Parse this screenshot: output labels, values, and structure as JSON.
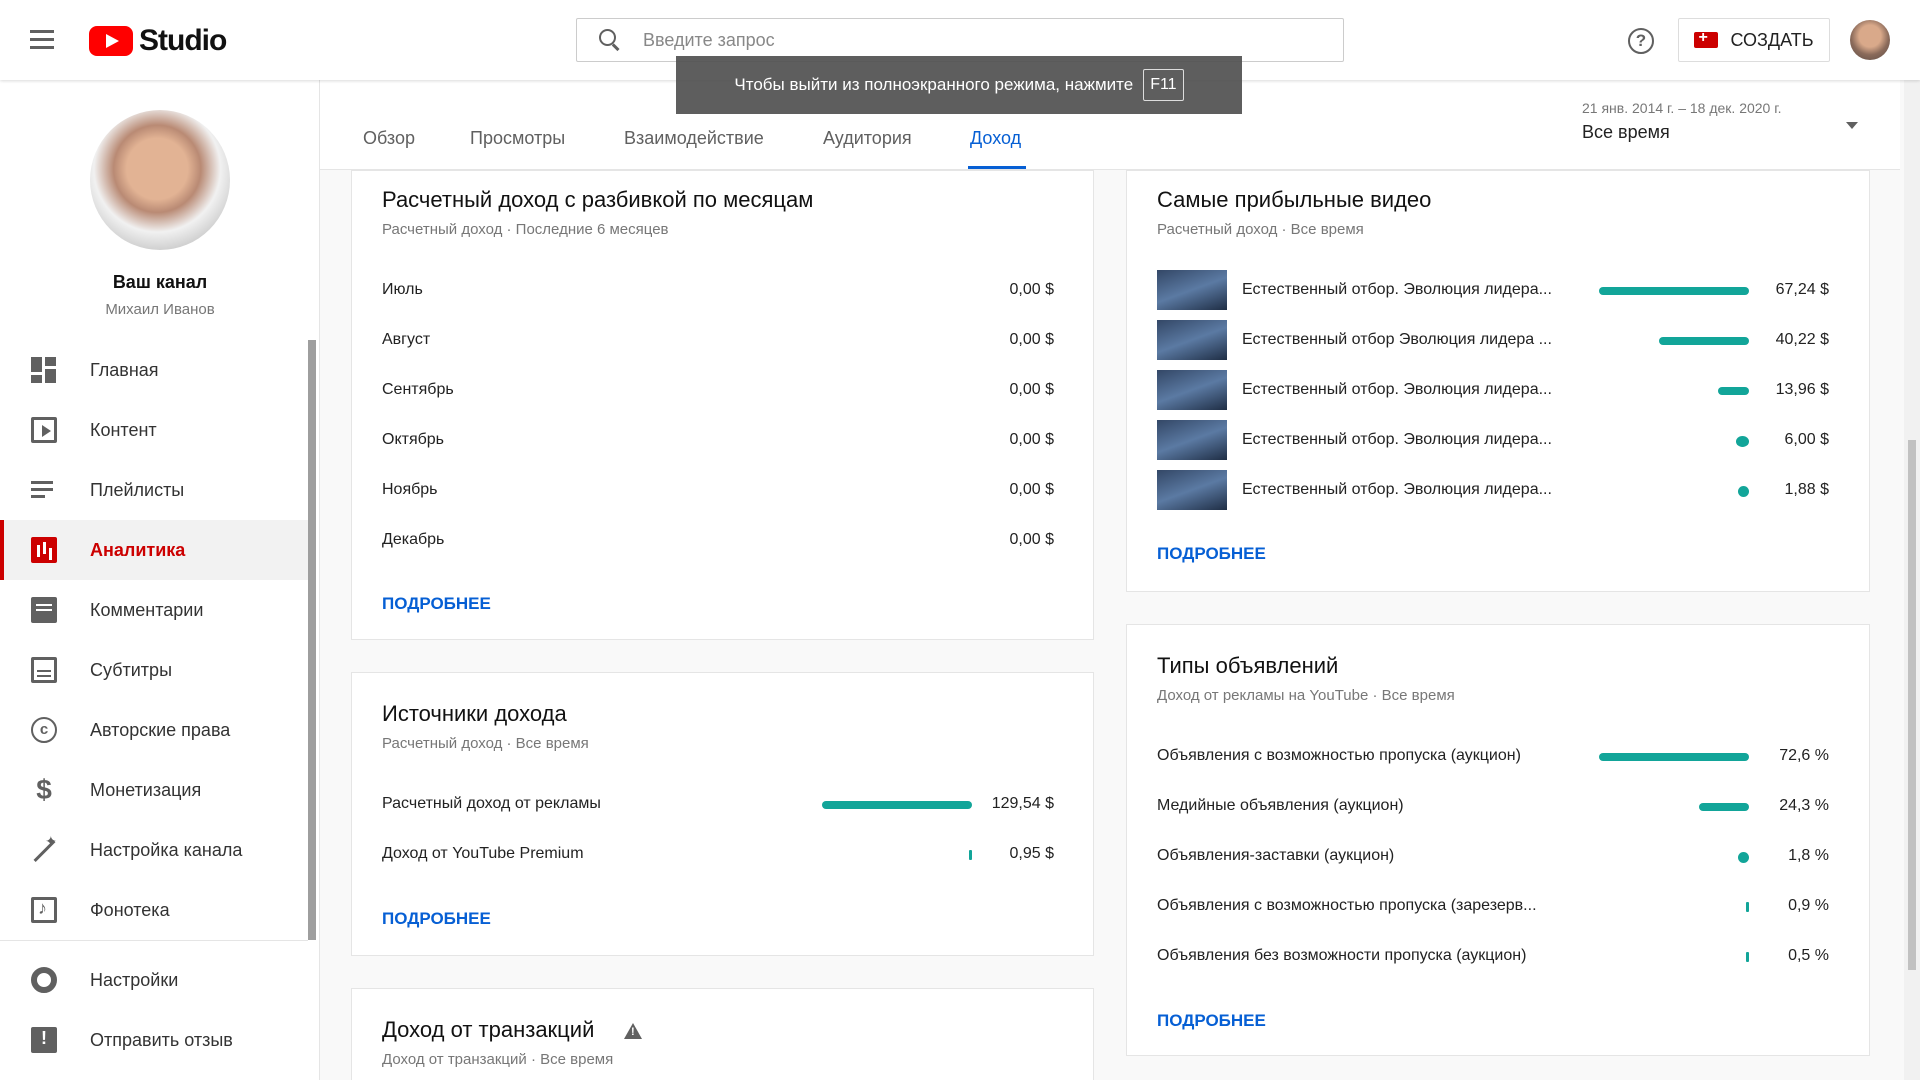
{
  "header": {
    "logo_text": "Studio",
    "search_placeholder": "Введите запрос",
    "help_glyph": "?",
    "create_label": "СОЗДАТЬ"
  },
  "toast": {
    "text": "Чтобы выйти из полноэкранного режима, нажмите",
    "key": "F11"
  },
  "sidebar": {
    "channel_name": "Ваш канал",
    "channel_owner": "Михаил Иванов",
    "items": [
      {
        "label": "Главная",
        "icon": "dashboard-icon"
      },
      {
        "label": "Контент",
        "icon": "video-library-icon"
      },
      {
        "label": "Плейлисты",
        "icon": "playlist-icon"
      },
      {
        "label": "Аналитика",
        "icon": "analytics-icon",
        "active": true
      },
      {
        "label": "Комментарии",
        "icon": "comment-icon"
      },
      {
        "label": "Субтитры",
        "icon": "subtitles-icon"
      },
      {
        "label": "Авторские права",
        "icon": "copyright-icon"
      },
      {
        "label": "Монетизация",
        "icon": "dollar-icon"
      },
      {
        "label": "Настройка канала",
        "icon": "magic-wand-icon"
      },
      {
        "label": "Фонотека",
        "icon": "audio-library-icon"
      }
    ],
    "bottom_items": [
      {
        "label": "Настройки",
        "icon": "gear-icon"
      },
      {
        "label": "Отправить отзыв",
        "icon": "feedback-icon"
      }
    ]
  },
  "tabs": [
    {
      "label": "Обзор"
    },
    {
      "label": "Просмотры"
    },
    {
      "label": "Взаимодействие"
    },
    {
      "label": "Аудитория"
    },
    {
      "label": "Доход",
      "active": true
    }
  ],
  "date_range": {
    "range_text": "21 янв. 2014 г. – 18 дек. 2020 г.",
    "selected": "Все время"
  },
  "monthly_revenue": {
    "title": "Расчетный доход с разбивкой по месяцам",
    "subtitle": "Расчетный доход · Последние 6 месяцев",
    "rows": [
      {
        "label": "Июль",
        "value": "0,00 $"
      },
      {
        "label": "Август",
        "value": "0,00 $"
      },
      {
        "label": "Сентябрь",
        "value": "0,00 $"
      },
      {
        "label": "Октябрь",
        "value": "0,00 $"
      },
      {
        "label": "Ноябрь",
        "value": "0,00 $"
      },
      {
        "label": "Декабрь",
        "value": "0,00 $"
      }
    ],
    "more": "ПОДРОБНЕЕ"
  },
  "revenue_sources": {
    "title": "Источники дохода",
    "subtitle": "Расчетный доход · Все время",
    "rows": [
      {
        "label": "Расчетный доход от рекламы",
        "value": "129,54 $",
        "share": 1.0
      },
      {
        "label": "Доход от YouTube Premium",
        "value": "0,95 $",
        "share": 0.007
      }
    ],
    "more": "ПОДРОБНЕЕ"
  },
  "transactions": {
    "title": "Доход от транзакций",
    "subtitle": "Доход от транзакций · Все время",
    "warning_icon": "warning-icon"
  },
  "top_videos": {
    "title": "Самые прибыльные видео",
    "subtitle": "Расчетный доход · Все время",
    "rows": [
      {
        "label": "Естественный отбор. Эволюция лидера...",
        "value": "67,24 $",
        "share": 1.0
      },
      {
        "label": "Естественный отбор Эволюция лидера ...",
        "value": "40,22 $",
        "share": 0.598
      },
      {
        "label": "Естественный отбор. Эволюция лидера...",
        "value": "13,96 $",
        "share": 0.208
      },
      {
        "label": "Естественный отбор. Эволюция лидера...",
        "value": "6,00 $",
        "share": 0.089
      },
      {
        "label": "Естественный отбор. Эволюция лидера...",
        "value": "1,88 $",
        "share": 0.028
      }
    ],
    "more": "ПОДРОБНЕЕ"
  },
  "ad_types": {
    "title": "Типы объявлений",
    "subtitle": "Доход от рекламы на YouTube · Все время",
    "rows": [
      {
        "label": "Объявления с возможностью пропуска (аукцион)",
        "value": "72,6 %",
        "share": 1.0
      },
      {
        "label": "Медийные объявления (аукцион)",
        "value": "24,3 %",
        "share": 0.335
      },
      {
        "label": "Объявления-заставки (аукцион)",
        "value": "1,8 %",
        "share": 0.025
      },
      {
        "label": "Объявления с возможностью пропуска (зарезерв...",
        "value": "0,9 %",
        "share": 0.012
      },
      {
        "label": "Объявления без возможности пропуска (аукцион)",
        "value": "0,5 %",
        "share": 0.007
      }
    ],
    "more": "ПОДРОБНЕЕ"
  },
  "colors": {
    "accent_blue": "#065fd4",
    "active_red": "#cc0000",
    "bar_teal": "#12a599"
  }
}
